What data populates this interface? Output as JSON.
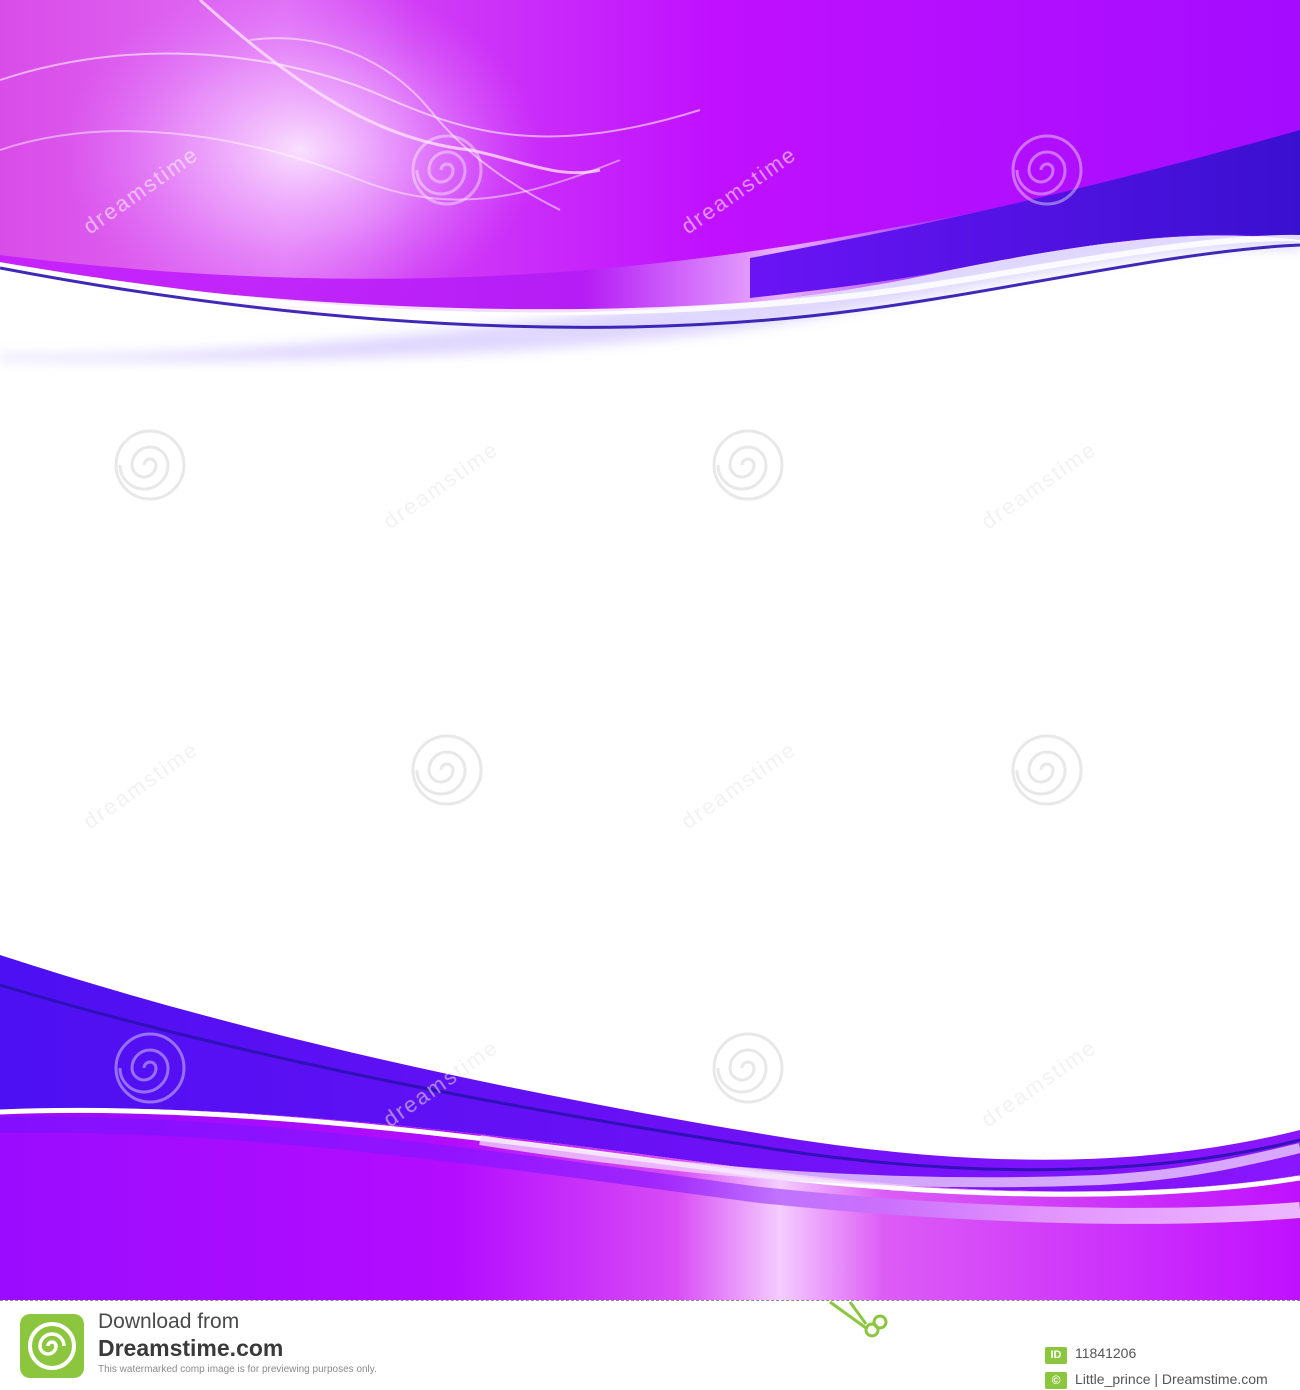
{
  "artwork": {
    "description_colors": {
      "violet": "#b400ff",
      "magenta": "#d33cf5",
      "blue": "#4a10f0",
      "deep_blue": "#2b12c0",
      "highlight": "#f7d4ff",
      "watermark": "#e6e6e6"
    },
    "watermark_text": "dreamstime"
  },
  "footer": {
    "download_label": "Download from",
    "brand": "Dreamstime.com",
    "disclaimer": "This watermarked comp image is for previewing purposes only.",
    "id_badge": "ID",
    "image_id": "11841206",
    "copyright_badge": "©",
    "credit": "Little_prince | Dreamstime.com",
    "accent_green": "#8cc63f",
    "scissors_icon": "scissors-icon"
  }
}
